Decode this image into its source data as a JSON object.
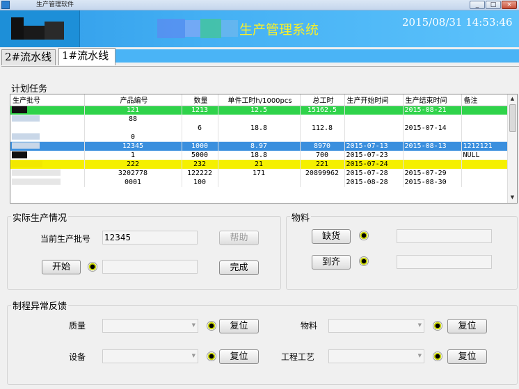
{
  "window": {
    "title": "生产管理软件",
    "min": "_",
    "max": "□",
    "close": "×"
  },
  "header": {
    "system_title": "生产管理系统",
    "datetime": "2015/08/31  14:53:46"
  },
  "tabs": [
    {
      "label": "2#流水线"
    },
    {
      "label": "1#流水线"
    }
  ],
  "plan": {
    "title": "计划任务",
    "columns": [
      "生产批号",
      "产品编号",
      "数量",
      "单件工时h/1000pcs",
      "总工时",
      "生产开始时间",
      "生产结束时间",
      "备注"
    ],
    "rows": [
      {
        "style": "green",
        "cells": [
          "",
          "121",
          "1213",
          "12.5",
          "15162.5",
          "",
          "2015-08-21",
          ""
        ]
      },
      {
        "style": "white",
        "cells": [
          "",
          "88",
          "",
          "",
          "",
          "",
          "",
          ""
        ]
      },
      {
        "style": "white",
        "cells": [
          "",
          "",
          "6",
          "18.8",
          "112.8",
          "",
          "2015-07-14",
          ""
        ]
      },
      {
        "style": "white",
        "cells": [
          "",
          "0",
          "",
          "",
          "",
          "",
          "",
          ""
        ]
      },
      {
        "style": "blue",
        "cells": [
          "",
          "12345",
          "1000",
          "8.97",
          "8970",
          "2015-07-13",
          "2015-08-13",
          "1212121"
        ]
      },
      {
        "style": "white",
        "cells": [
          "",
          "1",
          "5000",
          "18.8",
          "700",
          "2015-07-23",
          "",
          "NULL"
        ]
      },
      {
        "style": "yellow",
        "cells": [
          "",
          "222",
          "232",
          "21",
          "221",
          "2015-07-24",
          "",
          ""
        ]
      },
      {
        "style": "white",
        "cells": [
          "",
          "3202778",
          "122222",
          "171",
          "20899962",
          "2015-07-28",
          "2015-07-29",
          ""
        ]
      },
      {
        "style": "white",
        "cells": [
          "",
          "0001",
          "100",
          "",
          "",
          "2015-08-28",
          "2015-08-30",
          ""
        ]
      }
    ],
    "scroll_up": "▲",
    "scroll_down": "▼"
  },
  "actual": {
    "title": "实际生产情况",
    "batch_label": "当前生产批号",
    "batch_value": "12345",
    "help_label": "帮助",
    "start_label": "开始",
    "finish_label": "完成"
  },
  "material": {
    "title": "物料",
    "shortage_label": "缺货",
    "ready_label": "到齐"
  },
  "feedback": {
    "title": "制程异常反馈",
    "quality_label": "质量",
    "equipment_label": "设备",
    "material_label": "物料",
    "process_label": "工程工艺",
    "reset_label": "复位",
    "combo_arrow": "▼"
  }
}
